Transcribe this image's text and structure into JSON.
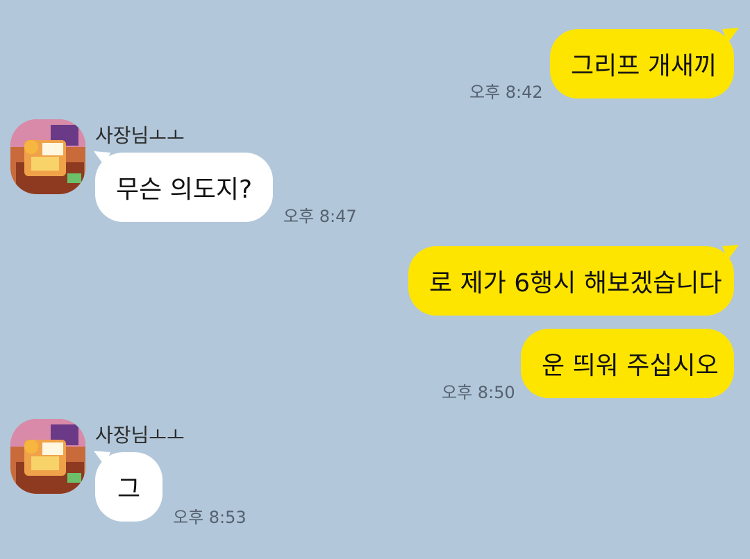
{
  "chat": {
    "messages": [
      {
        "text": "그리프 개새끼",
        "time": "오후 8:42"
      },
      {
        "sender": "사장님ㅗㅗ",
        "text": "무슨 의도지?",
        "time": "오후 8:47"
      },
      {
        "text": "로 제가 6행시 해보겠습니다"
      },
      {
        "text": "운 띄워 주십시오",
        "time": "오후 8:50"
      },
      {
        "sender": "사장님ㅗㅗ",
        "text": "그",
        "time": "오후 8:53"
      }
    ]
  },
  "colors": {
    "background": "#b2c7da",
    "my_bubble": "#fee500",
    "their_bubble": "#ffffff",
    "timestamp": "#556170"
  },
  "icons": {
    "avatar": "profile-avatar-icon"
  }
}
